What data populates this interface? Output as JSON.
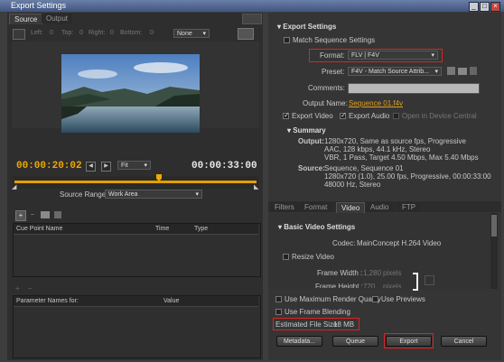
{
  "window": {
    "title": "Export Settings"
  },
  "left": {
    "tabs": [
      "Source",
      "Output"
    ],
    "crop": {
      "left_label": "Left:",
      "left_val": "0",
      "top_label": "Top:",
      "top_val": "0",
      "right_label": "Right:",
      "right_val": "0",
      "bottom_label": "Bottom:",
      "bottom_val": "0",
      "ratio": "None"
    },
    "timecode_current": "00:00:20:02",
    "fit_label": "Fit",
    "timecode_total": "00:00:33:00",
    "source_range_label": "Source Range:",
    "source_range_value": "Work Area",
    "cue_columns": [
      "Cue Point Name",
      "Time",
      "Type"
    ],
    "param_columns": [
      "Parameter Names for:",
      "Value"
    ]
  },
  "export_settings": {
    "header": "Export Settings",
    "match_sequence": "Match Sequence Settings",
    "format_label": "Format:",
    "format_value": "FLV | F4V",
    "preset_label": "Preset:",
    "preset_value": "F4V - Match Source Attrib...",
    "comments_label": "Comments:",
    "output_name_label": "Output Name:",
    "output_name_value": "Sequence 01.f4v",
    "export_video": "Export Video",
    "export_audio": "Export Audio",
    "open_device": "Open in Device Central"
  },
  "summary": {
    "header": "Summary",
    "output_label": "Output:",
    "output_lines": [
      "1280x720, Same as source fps, Progressive",
      "AAC, 128 kbps, 44.1 kHz, Stereo",
      "VBR, 1 Pass, Target 4.50 Mbps, Max 5.40 Mbps"
    ],
    "source_label": "Source:",
    "source_lines": [
      "Sequence, Sequence 01",
      "1280x720 (1.0), 25.00 fps, Progressive, 00:00:33:00",
      "48000 Hz, Stereo"
    ]
  },
  "settings_tabs": [
    "Filters",
    "Format",
    "Video",
    "Audio",
    "FTP"
  ],
  "video": {
    "header": "Basic Video Settings",
    "codec_label": "Codec:",
    "codec_value": "MainConcept H.264 Video",
    "resize_label": "Resize Video",
    "frame_width_label": "Frame Width :",
    "frame_width_value": "1,280",
    "frame_height_label": "Frame Height :",
    "frame_height_value": "720",
    "pixels": "pixels"
  },
  "bottom": {
    "max_render": "Use Maximum Render Quality",
    "use_previews": "Use Previews",
    "frame_blending": "Use Frame Blending",
    "file_size_label": "Estimated File Size:",
    "file_size_value": "18 MB",
    "metadata": "Metadata...",
    "queue": "Queue",
    "export": "Export",
    "cancel": "Cancel"
  },
  "colors": {
    "timecode": "#f0a800",
    "accent_red": "#d22222",
    "link": "#e0a020"
  }
}
